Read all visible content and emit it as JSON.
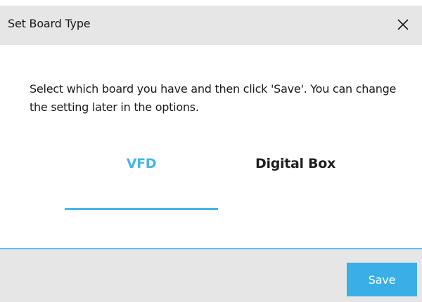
{
  "dialog": {
    "title": "Set Board Type",
    "close_icon": "close-icon",
    "message": "Select which board you have and then click 'Save'. You can change the setting later in the options."
  },
  "tabs": [
    {
      "label": "VFD",
      "selected": true
    },
    {
      "label": "Digital Box",
      "selected": false
    }
  ],
  "footer": {
    "save_label": "Save"
  },
  "colors": {
    "accent": "#48b6ea",
    "button": "#3aaee7",
    "titlebar_bg": "#e6e6e6",
    "text": "#1a1a1a"
  }
}
